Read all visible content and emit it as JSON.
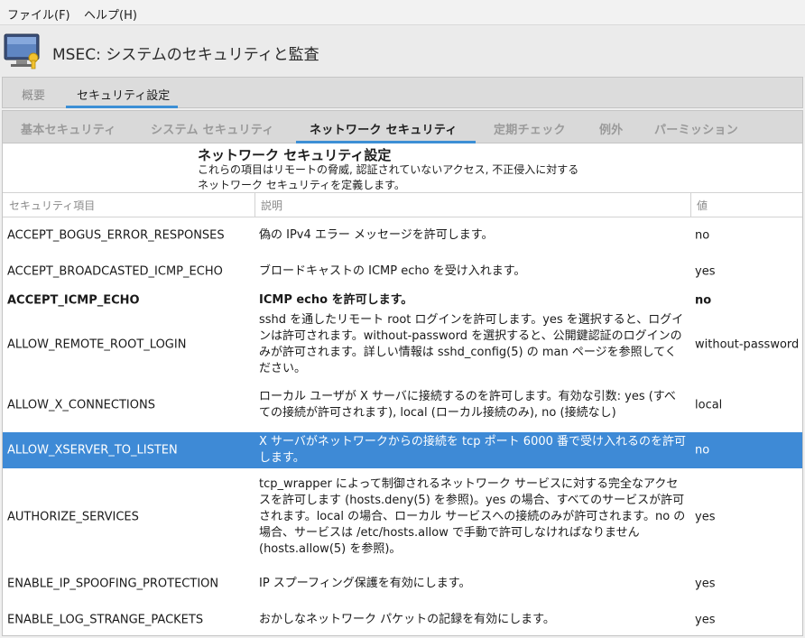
{
  "menu": {
    "file": "ファイル(F)",
    "help": "ヘルプ(H)"
  },
  "header": {
    "title": "MSEC: システムのセキュリティと監査"
  },
  "outer_tabs": [
    "概要",
    "セキュリティ設定"
  ],
  "inner_tabs": [
    "基本セキュリティ",
    "システム セキュリティ",
    "ネットワーク セキュリティ",
    "定期チェック",
    "例外",
    "パーミッション"
  ],
  "section": {
    "title": "ネットワーク セキュリティ設定",
    "desc_line1": "これらの項目はリモートの脅威, 認証されていないアクセス, 不正侵入に対する",
    "desc_line2": "ネットワーク セキュリティを定義します。"
  },
  "table": {
    "headers": [
      "セキュリティ項目",
      "説明",
      "値"
    ],
    "rows": [
      {
        "name": "ACCEPT_BOGUS_ERROR_RESPONSES",
        "desc": "偽の IPv4 エラー メッセージを許可します。",
        "value": "no"
      },
      {
        "name": "ACCEPT_BROADCASTED_ICMP_ECHO",
        "desc": "ブロードキャストの ICMP echo を受け入れます。",
        "value": "yes"
      },
      {
        "name": "ACCEPT_ICMP_ECHO",
        "desc": "ICMP echo を許可します。",
        "value": "no"
      },
      {
        "name": "ALLOW_REMOTE_ROOT_LOGIN",
        "desc": "sshd を通したリモート root ログインを許可します。yes を選択すると、ログインは許可されます。without-password を選択すると、公開鍵認証のログインのみが許可されます。詳しい情報は sshd_config(5) の man ページを参照してください。",
        "value": "without-password"
      },
      {
        "name": "ALLOW_X_CONNECTIONS",
        "desc": "ローカル ユーザが X サーバに接続するのを許可します。有効な引数: yes (すべての接続が許可されます), local (ローカル接続のみ), no (接続なし)",
        "value": "local"
      },
      {
        "name": "ALLOW_XSERVER_TO_LISTEN",
        "desc": "X サーバがネットワークからの接続を tcp ポート 6000 番で受け入れるのを許可します。",
        "value": "no"
      },
      {
        "name": "AUTHORIZE_SERVICES",
        "desc": "tcp_wrapper によって制御されるネットワーク サービスに対する完全なアクセスを許可します (hosts.deny(5) を参照)。yes の場合、すべてのサービスが許可されます。local の場合、ローカル サービスへの接続のみが許可されます。no の場合、サービスは /etc/hosts.allow で手動で許可しなければなりません (hosts.allow(5) を参照)。",
        "value": "yes"
      },
      {
        "name": "ENABLE_IP_SPOOFING_PROTECTION",
        "desc": "IP スプーフィング保護を有効にします。",
        "value": "yes"
      },
      {
        "name": "ENABLE_LOG_STRANGE_PACKETS",
        "desc": "おかしなネットワーク パケットの記録を有効にします。",
        "value": "yes"
      }
    ]
  },
  "colors": {
    "accent": "#3c8fd5",
    "selected_row": "#3e8ad6"
  }
}
